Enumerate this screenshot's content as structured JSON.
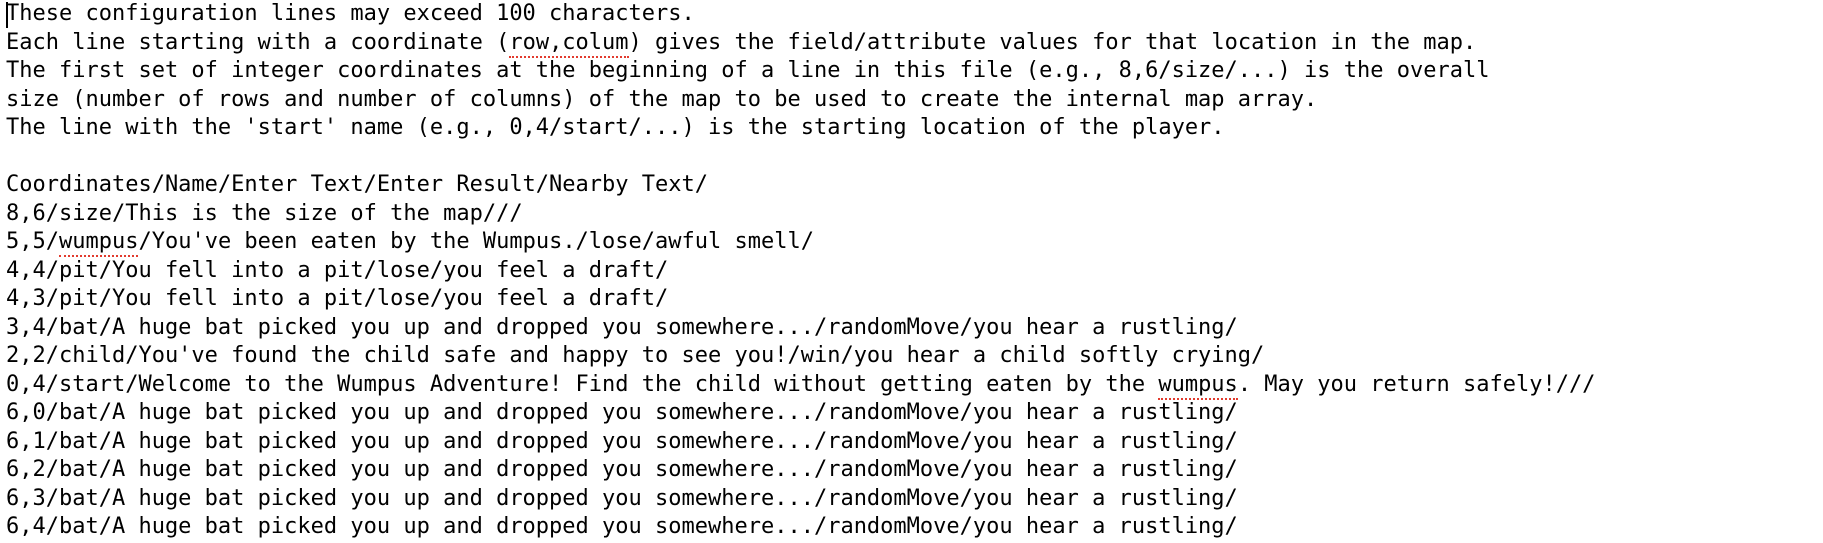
{
  "editor": {
    "caret_line": 0,
    "caret_col": 0,
    "lines": [
      {
        "fragments": [
          {
            "text": "These configuration lines may exceed 100 characters.",
            "spell": false
          }
        ]
      },
      {
        "fragments": [
          {
            "text": "Each line starting with a coordinate (",
            "spell": false
          },
          {
            "text": "row,colum",
            "spell": true
          },
          {
            "text": ") gives the field/attribute values for that location in the map.",
            "spell": false
          }
        ]
      },
      {
        "fragments": [
          {
            "text": "The first set of integer coordinates at the beginning of a line in this file (e.g., 8,6/size/...) is the overall",
            "spell": false
          }
        ]
      },
      {
        "fragments": [
          {
            "text": "size (number of rows and number of columns) of the map to be used to create the internal map array.",
            "spell": false
          }
        ]
      },
      {
        "fragments": [
          {
            "text": "The line with the 'start' name (e.g., 0,4/start/...) is the starting location of the player.",
            "spell": false
          }
        ]
      },
      {
        "fragments": [
          {
            "text": "",
            "spell": false
          }
        ]
      },
      {
        "fragments": [
          {
            "text": "Coordinates/Name/Enter Text/Enter Result/Nearby Text/",
            "spell": false
          }
        ]
      },
      {
        "fragments": [
          {
            "text": "8,6/size/This is the size of the map///",
            "spell": false
          }
        ]
      },
      {
        "fragments": [
          {
            "text": "5,5/",
            "spell": false
          },
          {
            "text": "wumpus",
            "spell": true
          },
          {
            "text": "/You've been eaten by the Wumpus./lose/awful smell/",
            "spell": false
          }
        ]
      },
      {
        "fragments": [
          {
            "text": "4,4/pit/You fell into a pit/lose/you feel a draft/",
            "spell": false
          }
        ]
      },
      {
        "fragments": [
          {
            "text": "4,3/pit/You fell into a pit/lose/you feel a draft/",
            "spell": false
          }
        ]
      },
      {
        "fragments": [
          {
            "text": "3,4/bat/A huge bat picked you up and dropped you somewhere.../randomMove/you hear a rustling/",
            "spell": false
          }
        ]
      },
      {
        "fragments": [
          {
            "text": "2,2/child/You've found the child safe and happy to see you!/win/you hear a child softly crying/",
            "spell": false
          }
        ]
      },
      {
        "fragments": [
          {
            "text": "0,4/start/Welcome to the Wumpus Adventure! Find the child without getting eaten by the ",
            "spell": false
          },
          {
            "text": "wumpus",
            "spell": true
          },
          {
            "text": ". May you return safely!///",
            "spell": false
          }
        ]
      },
      {
        "fragments": [
          {
            "text": "6,0/bat/A huge bat picked you up and dropped you somewhere.../randomMove/you hear a rustling/",
            "spell": false
          }
        ]
      },
      {
        "fragments": [
          {
            "text": "6,1/bat/A huge bat picked you up and dropped you somewhere.../randomMove/you hear a rustling/",
            "spell": false
          }
        ]
      },
      {
        "fragments": [
          {
            "text": "6,2/bat/A huge bat picked you up and dropped you somewhere.../randomMove/you hear a rustling/",
            "spell": false
          }
        ]
      },
      {
        "fragments": [
          {
            "text": "6,3/bat/A huge bat picked you up and dropped you somewhere.../randomMove/you hear a rustling/",
            "spell": false
          }
        ]
      },
      {
        "fragments": [
          {
            "text": "6,4/bat/A huge bat picked you up and dropped you somewhere.../randomMove/you hear a rustling/",
            "spell": false
          }
        ]
      }
    ]
  }
}
